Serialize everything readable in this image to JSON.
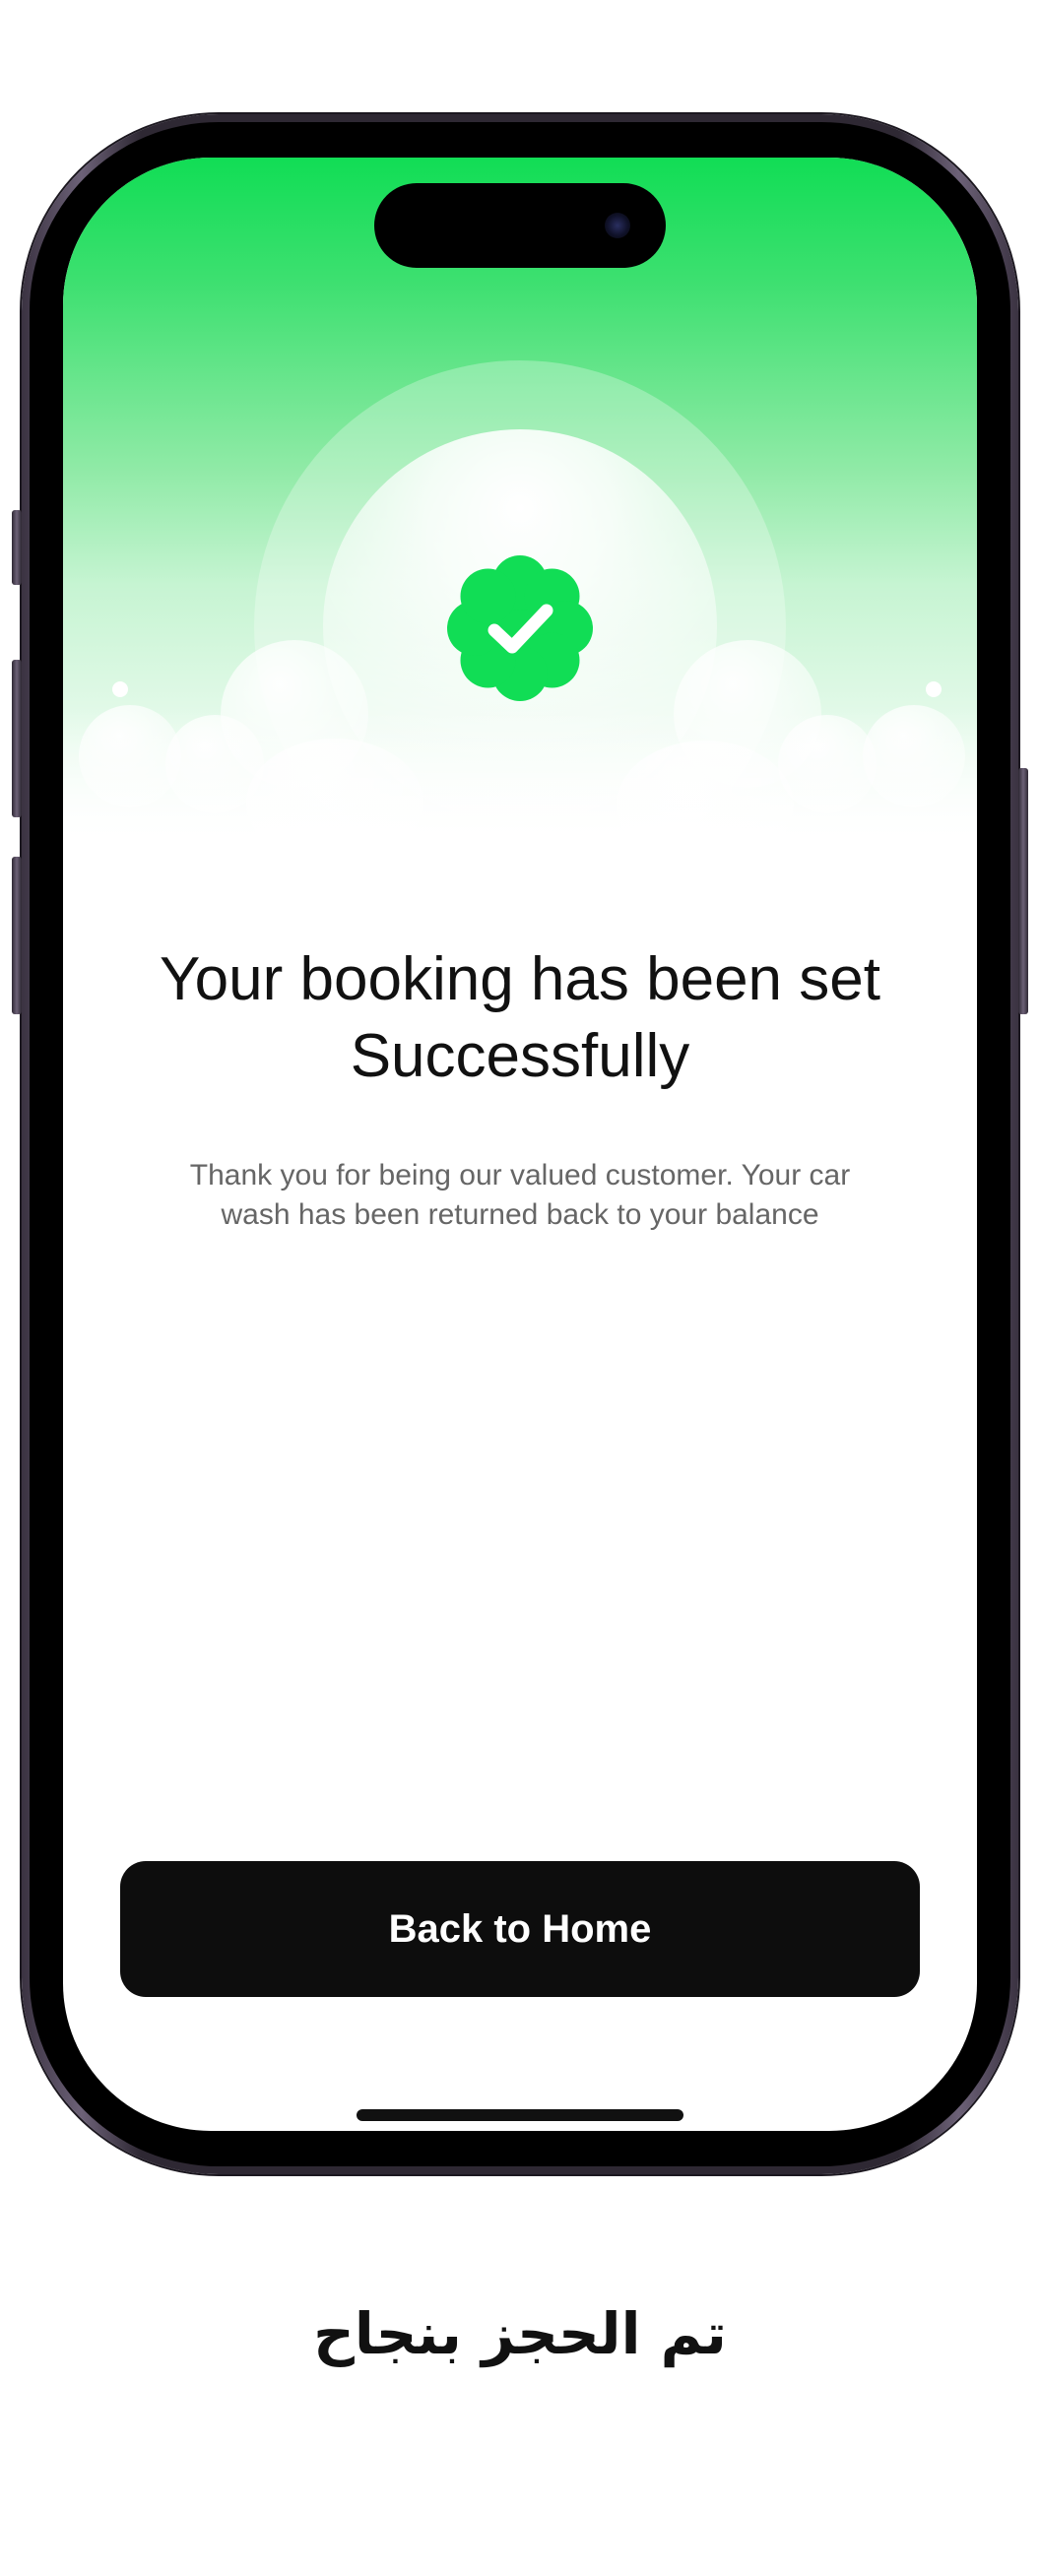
{
  "screen": {
    "title": "Your booking has been set Successfully",
    "message": "Thank you for being our valued customer. Your car wash has been returned back to your balance",
    "primary_button": "Back to Home"
  },
  "caption": "تم الحجز بنجاح",
  "icons": {
    "success": "verified-check-badge-icon"
  },
  "colors": {
    "accent_green": "#11DD55",
    "button_background": "#0D0D0D",
    "button_text": "#FFFFFF",
    "heading_text": "#111111",
    "body_text": "#666666"
  }
}
